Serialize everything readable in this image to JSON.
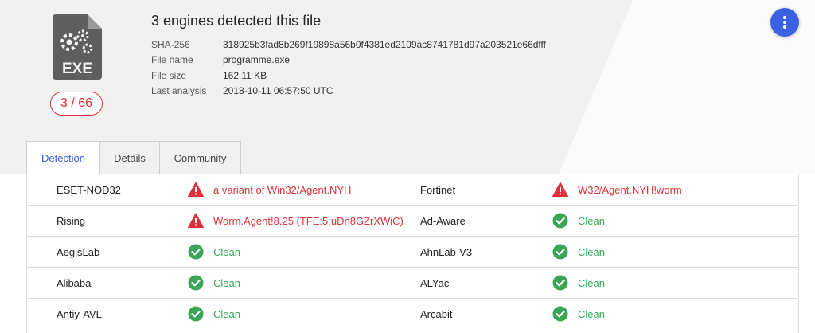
{
  "file": {
    "type_label": "EXE",
    "score": "3 / 66",
    "title": "3 engines detected this file",
    "meta": [
      {
        "label": "SHA-256",
        "value": "318925b3fad8b269f19898a56b0f4381ed2109ac8741781d97a203521e66dfff"
      },
      {
        "label": "File name",
        "value": "programme.exe"
      },
      {
        "label": "File size",
        "value": "162.11 KB"
      },
      {
        "label": "Last analysis",
        "value": "2018-10-11 06:57:50 UTC"
      }
    ]
  },
  "tabs": [
    {
      "label": "Detection",
      "active": true
    },
    {
      "label": "Details",
      "active": false
    },
    {
      "label": "Community",
      "active": false
    }
  ],
  "colors": {
    "accent": "#3b61e3",
    "malicious": "#e0303a",
    "clean": "#3aa655"
  },
  "icons": {
    "menu": "more-vertical-icon",
    "malicious": "warning-icon",
    "clean": "check-circle-icon"
  },
  "detections": [
    {
      "left": {
        "engine": "ESET-NOD32",
        "result": "a variant of Win32/Agent.NYH",
        "status": "malicious"
      },
      "right": {
        "engine": "Fortinet",
        "result": "W32/Agent.NYH!worm",
        "status": "malicious"
      }
    },
    {
      "left": {
        "engine": "Rising",
        "result": "Worm.Agent!8.25 (TFE:5:uDn8GZrXWiC)",
        "status": "malicious"
      },
      "right": {
        "engine": "Ad-Aware",
        "result": "Clean",
        "status": "clean"
      }
    },
    {
      "left": {
        "engine": "AegisLab",
        "result": "Clean",
        "status": "clean"
      },
      "right": {
        "engine": "AhnLab-V3",
        "result": "Clean",
        "status": "clean"
      }
    },
    {
      "left": {
        "engine": "Alibaba",
        "result": "Clean",
        "status": "clean"
      },
      "right": {
        "engine": "ALYac",
        "result": "Clean",
        "status": "clean"
      }
    },
    {
      "left": {
        "engine": "Antiy-AVL",
        "result": "Clean",
        "status": "clean"
      },
      "right": {
        "engine": "Arcabit",
        "result": "Clean",
        "status": "clean"
      }
    }
  ]
}
